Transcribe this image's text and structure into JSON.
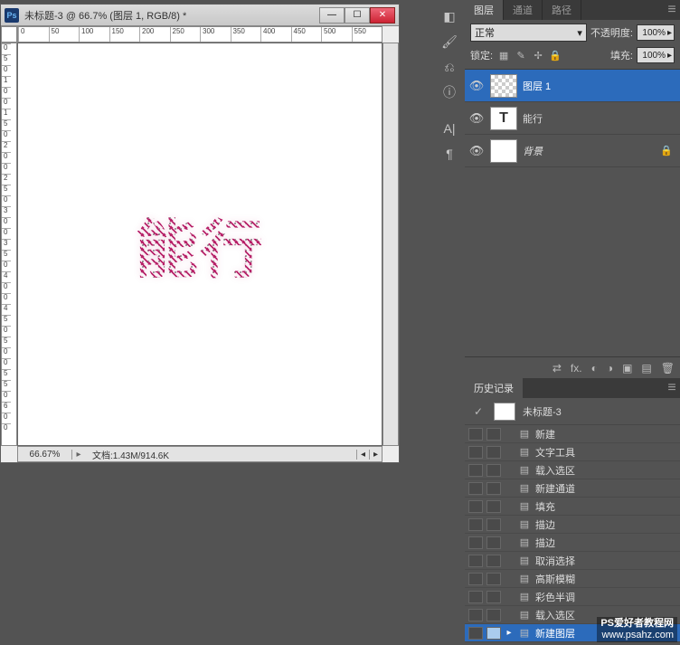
{
  "window": {
    "title": "未标题-3 @ 66.7% (图层 1, RGB/8) *",
    "zoom": "66.67%",
    "docinfo": "文档:1.43M/914.6K",
    "ruler_h": [
      "0",
      "50",
      "100",
      "150",
      "200",
      "250",
      "300",
      "350",
      "400",
      "450",
      "500",
      "550"
    ],
    "ruler_v": [
      "0",
      "5",
      "0",
      "1",
      "0",
      "0",
      "1",
      "5",
      "0",
      "2",
      "0",
      "0",
      "2",
      "5",
      "0",
      "3",
      "0",
      "0",
      "3",
      "5",
      "0",
      "4",
      "0",
      "0",
      "4",
      "5",
      "0",
      "5",
      "0",
      "0",
      "5",
      "5",
      "0",
      "6",
      "0",
      "0"
    ]
  },
  "artwork_text": "能行",
  "layers_panel": {
    "tabs": [
      "图层",
      "通道",
      "路径"
    ],
    "blend_mode": "正常",
    "opacity_label": "不透明度:",
    "opacity_value": "100%",
    "lock_label": "锁定:",
    "fill_label": "填充:",
    "fill_value": "100%",
    "layers": [
      {
        "name": "图层 1",
        "type": "checker",
        "selected": true,
        "locked": false
      },
      {
        "name": "能行",
        "type": "text",
        "selected": false,
        "locked": false
      },
      {
        "name": "背景",
        "type": "white",
        "selected": false,
        "locked": true,
        "italic": true
      }
    ]
  },
  "history_panel": {
    "tab": "历史记录",
    "snapshot": "未标题-3",
    "items": [
      "新建",
      "文字工具",
      "载入选区",
      "新建通道",
      "填充",
      "描边",
      "描边",
      "取消选择",
      "高斯模糊",
      "彩色半调",
      "载入选区",
      "新建图层"
    ],
    "selected_index": 11
  },
  "watermark": {
    "line1": "PS爱好者教程网",
    "line2": "www.psahz.com"
  }
}
